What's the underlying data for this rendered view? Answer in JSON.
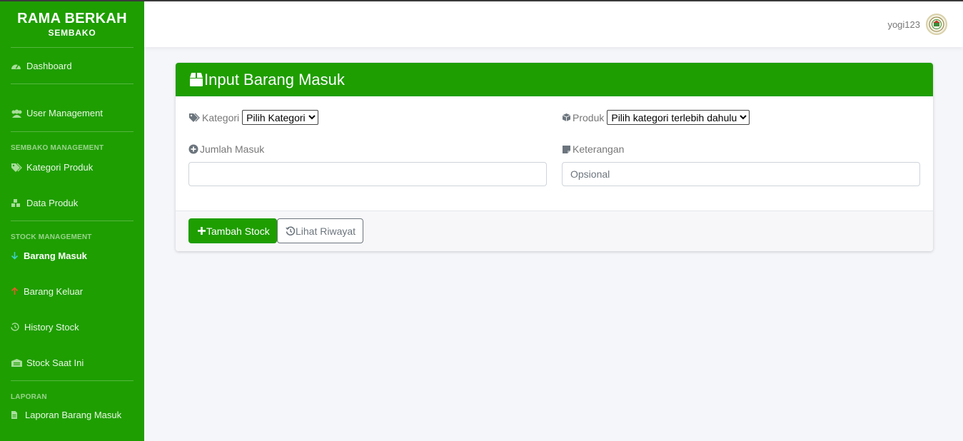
{
  "brand": {
    "title": "RAMA BERKAH",
    "subtitle": "SEMBAKO"
  },
  "sidebar": {
    "dashboard": "Dashboard",
    "user_management": "User Management",
    "section_sembako": "SEMBAKO MANAGEMENT",
    "kategori_produk": "Kategori Produk",
    "data_produk": "Data Produk",
    "section_stock": "STOCK MANAGEMENT",
    "barang_masuk": "Barang Masuk",
    "barang_keluar": "Barang Keluar",
    "history_stock": "History Stock",
    "stock_saat_ini": "Stock Saat Ini",
    "section_laporan": "LAPORAN",
    "laporan_barang_masuk": "Laporan Barang Masuk"
  },
  "topbar": {
    "username": "yogi123"
  },
  "card": {
    "title": "Input Barang Masuk",
    "kategori_label": "Kategori",
    "kategori_selected": "Pilih Kategori",
    "produk_label": "Produk",
    "produk_selected": "Pilih kategori terlebih dahulu",
    "jumlah_label": "Jumlah Masuk",
    "jumlah_value": "",
    "keterangan_label": "Keterangan",
    "keterangan_placeholder": "Opsional",
    "submit_label": "Tambah Stock",
    "history_label": "Lihat Riwayat"
  },
  "colors": {
    "primary": "#1e9e00",
    "background": "#f5f6fa",
    "arrow_in": "#3fd0c9",
    "arrow_out": "#e85a2a"
  }
}
